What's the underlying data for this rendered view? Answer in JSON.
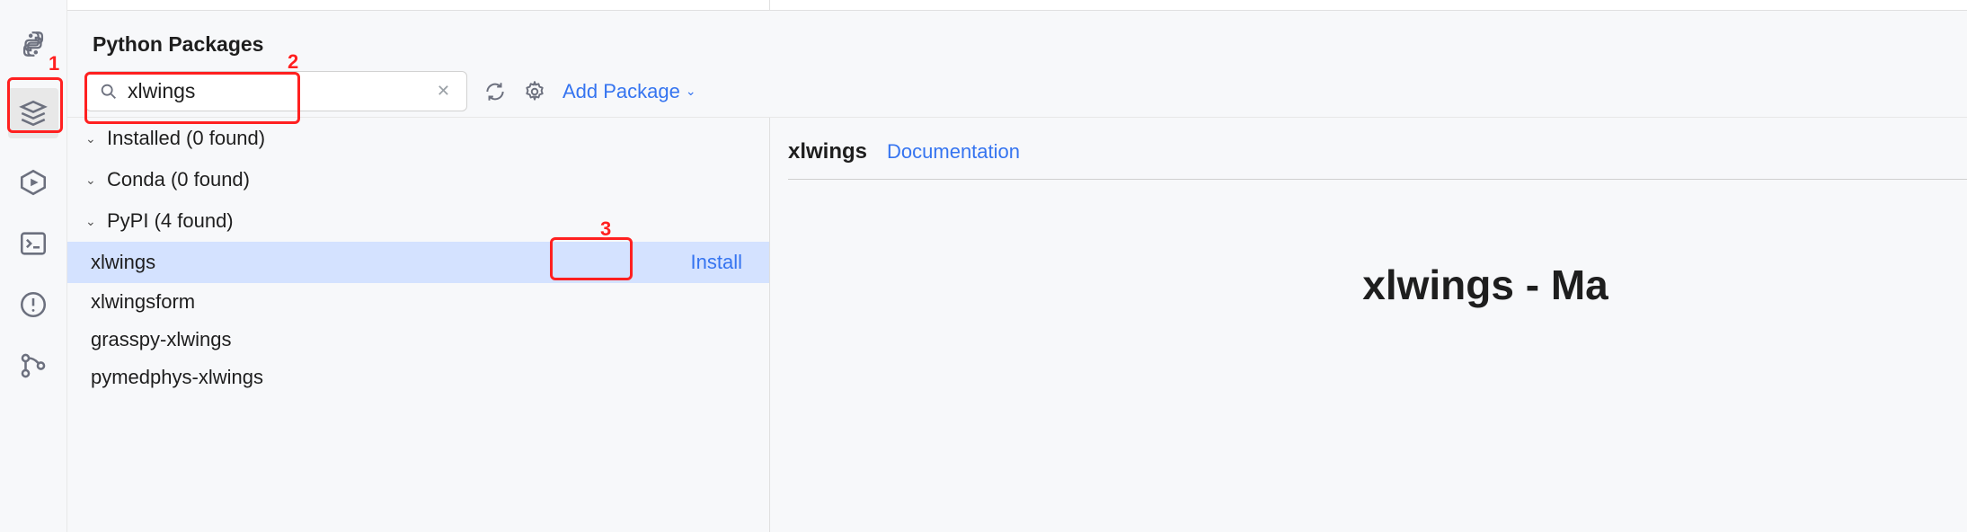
{
  "panel": {
    "title": "Python Packages"
  },
  "search": {
    "value": "xlwings",
    "placeholder": ""
  },
  "toolbar": {
    "add_package": "Add Package"
  },
  "groups": [
    {
      "label": "Installed (0 found)"
    },
    {
      "label": "Conda (0 found)"
    },
    {
      "label": "PyPI (4 found)"
    }
  ],
  "results": [
    {
      "name": "xlwings",
      "action": "Install",
      "selected": true
    },
    {
      "name": "xlwingsform"
    },
    {
      "name": "grasspy-xlwings"
    },
    {
      "name": "pymedphys-xlwings"
    }
  ],
  "details": {
    "name": "xlwings",
    "doc_link": "Documentation",
    "headline": "xlwings - Ma"
  },
  "callouts": {
    "n1": "1",
    "n2": "2",
    "n3": "3"
  }
}
